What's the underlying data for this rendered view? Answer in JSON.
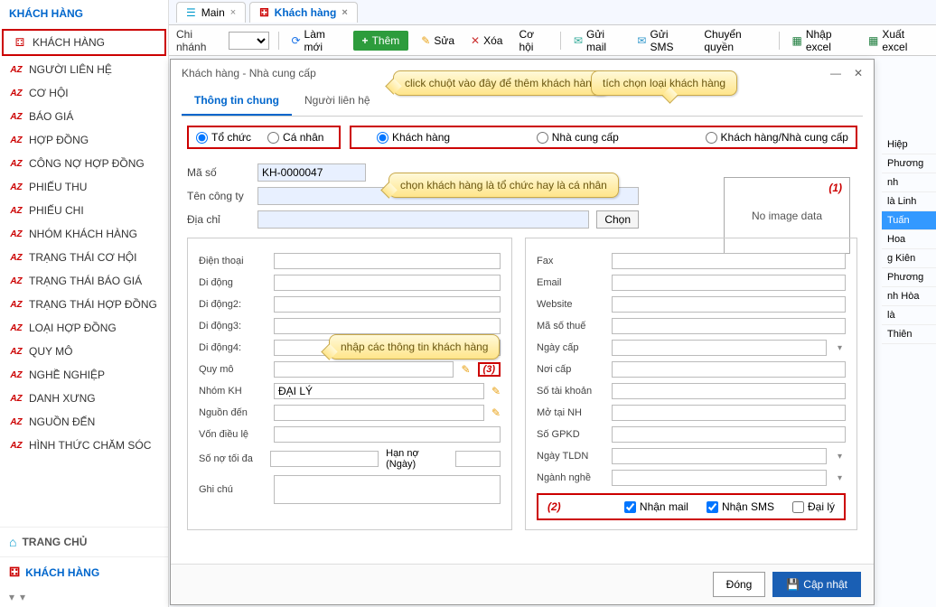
{
  "sidebar": {
    "header": "KHÁCH HÀNG",
    "items": [
      "KHÁCH HÀNG",
      "NGƯỜI LIÊN HỆ",
      "CƠ HỘI",
      "BÁO GIÁ",
      "HỢP ĐỒNG",
      "CÔNG NỢ HỢP ĐỒNG",
      "PHIẾU THU",
      "PHIẾU CHI",
      "NHÓM KHÁCH HÀNG",
      "TRẠNG THÁI CƠ HỘI",
      "TRẠNG THÁI BÁO GIÁ",
      "TRẠNG THÁI HỢP ĐỒNG",
      "LOẠI HỢP ĐỒNG",
      "QUY MÔ",
      "NGHỀ NGHIỆP",
      "DANH XƯNG",
      "NGUỒN ĐẾN",
      "HÌNH THỨC CHĂM SÓC"
    ],
    "footer_home": "TRANG CHỦ",
    "footer_kh": "KHÁCH HÀNG"
  },
  "tabs": {
    "main": "Main",
    "kh": "Khách hàng"
  },
  "toolbar": {
    "branch": "Chi nhánh",
    "refresh": "Làm mới",
    "add": "Thêm",
    "edit": "Sửa",
    "delete": "Xóa",
    "opportunity": "Cơ hội",
    "sendmail": "Gửi mail",
    "sendsms": "Gửi SMS",
    "transfer": "Chuyển quyền",
    "import": "Nhập excel",
    "export": "Xuất excel"
  },
  "rightlist": [
    "Hiệp",
    "Phương",
    "nh",
    "là Linh",
    "Tuấn",
    "Hoa",
    "g Kiên",
    "Phương",
    "nh Hòa",
    "là",
    "Thiên"
  ],
  "dialog": {
    "title": "Khách hàng - Nhà cung cấp",
    "tab_general": "Thông tin chung",
    "tab_contact": "Người liên hệ",
    "r_org": "Tổ chức",
    "r_pers": "Cá nhân",
    "r_cust": "Khách hàng",
    "r_supp": "Nhà cung cấp",
    "r_both": "Khách hàng/Nhà cung cấp",
    "code_label": "Mã số",
    "code_value": "KH-0000047",
    "company_label": "Tên công ty",
    "address_label": "Địa chỉ",
    "choose": "Chọn",
    "noimage": "No image data",
    "marker1": "(1)",
    "left": {
      "phone": "Điện thoại",
      "mobile": "Di động",
      "mobile2": "Di động2:",
      "mobile3": "Di động3:",
      "mobile4": "Di động4:",
      "scale": "Quy mô",
      "group": "Nhóm KH",
      "group_val": "ĐẠI LÝ",
      "source": "Nguồn đến",
      "capital": "Vốn điều lệ",
      "maxdebt": "Số nợ tối đa",
      "debtdays": "Hạn nợ (Ngày)",
      "note": "Ghi chú"
    },
    "right": {
      "fax": "Fax",
      "email": "Email",
      "website": "Website",
      "tax": "Mã số thuế",
      "issued": "Ngày cấp",
      "place": "Nơi cấp",
      "account": "Số tài khoản",
      "bank": "Mở tại NH",
      "license": "Số GPKD",
      "founded": "Ngày TLDN",
      "industry": "Ngành nghề"
    },
    "marker3": "(3)",
    "checks": {
      "num": "(2)",
      "mail": "Nhận mail",
      "sms": "Nhận SMS",
      "agent": "Đại lý"
    },
    "close": "Đóng",
    "update": "Cập nhật"
  },
  "callouts": {
    "c1": "click chuột vào đây để thêm khách hàng",
    "c2": "tích chọn loại khách hàng",
    "c3": "chọn khách hàng là tổ chức hay là cá nhân",
    "c4": "nhập các thông tin khách hàng"
  }
}
